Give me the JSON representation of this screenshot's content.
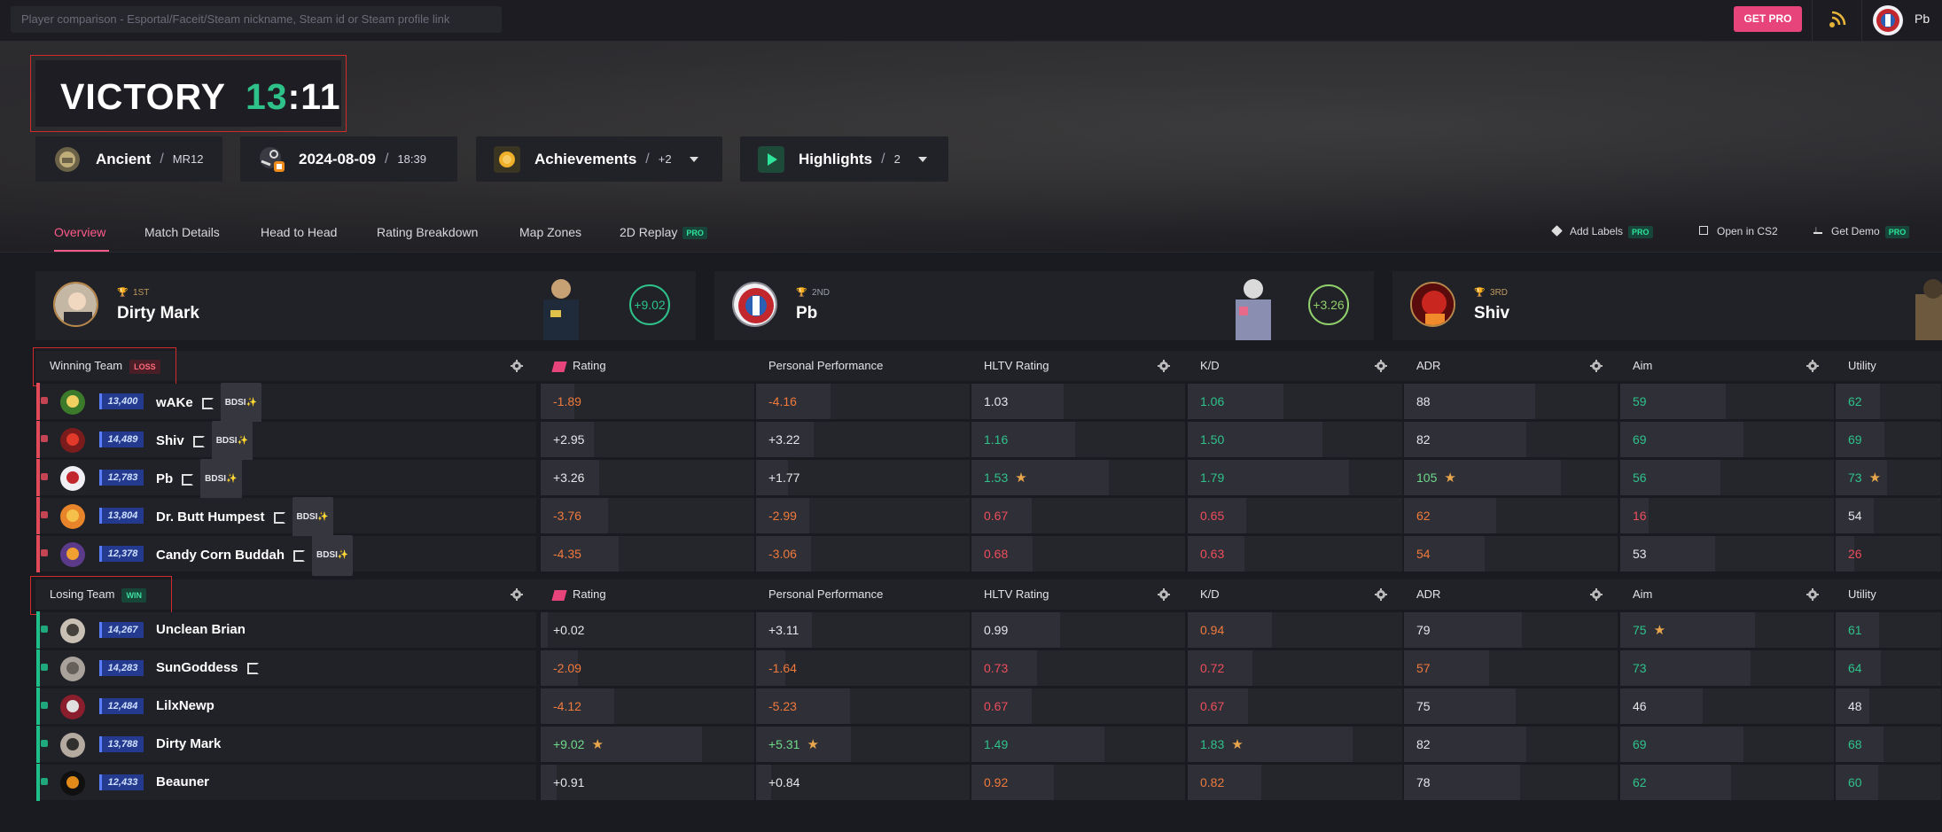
{
  "search": {
    "placeholder": "Player comparison - Esportal/Faceit/Steam nickname, Steam id or Steam profile link"
  },
  "topbar": {
    "get_pro": "GET PRO",
    "username": "Pb"
  },
  "result": {
    "title": "VICTORY",
    "score_a": "13",
    "sep": ":",
    "score_b": "11"
  },
  "info": {
    "map": "Ancient",
    "mode": "MR12",
    "date": "2024-08-09",
    "time": "18:39",
    "achievements": "Achievements",
    "achievements_extra": "+2",
    "highlights": "Highlights",
    "highlights_count": "2"
  },
  "tabs": {
    "overview": "Overview",
    "match_details": "Match Details",
    "head_to_head": "Head to Head",
    "rating_breakdown": "Rating Breakdown",
    "map_zones": "Map Zones",
    "replay": "2D Replay",
    "pro": "PRO",
    "add_labels": "Add Labels",
    "open_cs2": "Open in CS2",
    "get_demo": "Get Demo"
  },
  "top_players": [
    {
      "rank": "1ST",
      "name": "Dirty Mark",
      "delta": "+9.02"
    },
    {
      "rank": "2ND",
      "name": "Pb",
      "delta": "+3.26"
    },
    {
      "rank": "3RD",
      "name": "Shiv",
      "delta": ""
    }
  ],
  "columns": {
    "rating": "Rating",
    "personal": "Personal Performance",
    "hltv": "HLTV Rating",
    "kd": "K/D",
    "adr": "ADR",
    "aim": "Aim",
    "utility": "Utility"
  },
  "teams": [
    {
      "label": "Winning Team",
      "status": "LOSS",
      "players": [
        {
          "name": "wAKe",
          "elo": "13,400",
          "faceit": true,
          "bdsi": "BDSI✨",
          "rating": "-1.89",
          "personal": "-4.16",
          "hltv": "1.03",
          "kd": "1.06",
          "adr": "88",
          "aim": "59",
          "utility": "62"
        },
        {
          "name": "Shiv",
          "elo": "14,489",
          "faceit": true,
          "bdsi": "BDSI✨",
          "rating": "+2.95",
          "personal": "+3.22",
          "hltv": "1.16",
          "kd": "1.50",
          "adr": "82",
          "aim": "69",
          "utility": "69"
        },
        {
          "name": "Pb",
          "elo": "12,783",
          "faceit": true,
          "bdsi": "BDSI✨",
          "rating": "+3.26",
          "personal": "+1.77",
          "hltv": "1.53",
          "kd": "1.79",
          "adr": "105",
          "aim": "56",
          "utility": "73"
        },
        {
          "name": "Dr. Butt Humpest",
          "elo": "13,804",
          "faceit": true,
          "bdsi": "BDSI✨",
          "rating": "-3.76",
          "personal": "-2.99",
          "hltv": "0.67",
          "kd": "0.65",
          "adr": "62",
          "aim": "16",
          "utility": "54"
        },
        {
          "name": "Candy Corn Buddah",
          "elo": "12,378",
          "faceit": true,
          "bdsi": "BDSI✨",
          "rating": "-4.35",
          "personal": "-3.06",
          "hltv": "0.68",
          "kd": "0.63",
          "adr": "54",
          "aim": "53",
          "utility": "26"
        }
      ]
    },
    {
      "label": "Losing Team",
      "status": "WIN",
      "players": [
        {
          "name": "Unclean Brian",
          "elo": "14,267",
          "faceit": false,
          "bdsi": "",
          "rating": "+0.02",
          "personal": "+3.11",
          "hltv": "0.99",
          "kd": "0.94",
          "adr": "79",
          "aim": "75",
          "utility": "61"
        },
        {
          "name": "SunGoddess",
          "elo": "14,283",
          "faceit": true,
          "bdsi": "",
          "rating": "-2.09",
          "personal": "-1.64",
          "hltv": "0.73",
          "kd": "0.72",
          "adr": "57",
          "aim": "73",
          "utility": "64"
        },
        {
          "name": "LilxNewp",
          "elo": "12,484",
          "faceit": false,
          "bdsi": "",
          "rating": "-4.12",
          "personal": "-5.23",
          "hltv": "0.67",
          "kd": "0.67",
          "adr": "75",
          "aim": "46",
          "utility": "48"
        },
        {
          "name": "Dirty Mark",
          "elo": "13,788",
          "faceit": false,
          "bdsi": "",
          "rating": "+9.02",
          "personal": "+5.31",
          "hltv": "1.49",
          "kd": "1.83",
          "adr": "82",
          "aim": "69",
          "utility": "68"
        },
        {
          "name": "Beauner",
          "elo": "12,433",
          "faceit": false,
          "bdsi": "",
          "rating": "+0.91",
          "personal": "+0.84",
          "hltv": "0.92",
          "kd": "0.82",
          "adr": "78",
          "aim": "62",
          "utility": "60"
        }
      ]
    }
  ],
  "colors": {
    "accent_pink": "#e8447c",
    "green": "#2ec28a",
    "red": "#ee4d5c",
    "orange": "#f07a3c"
  }
}
